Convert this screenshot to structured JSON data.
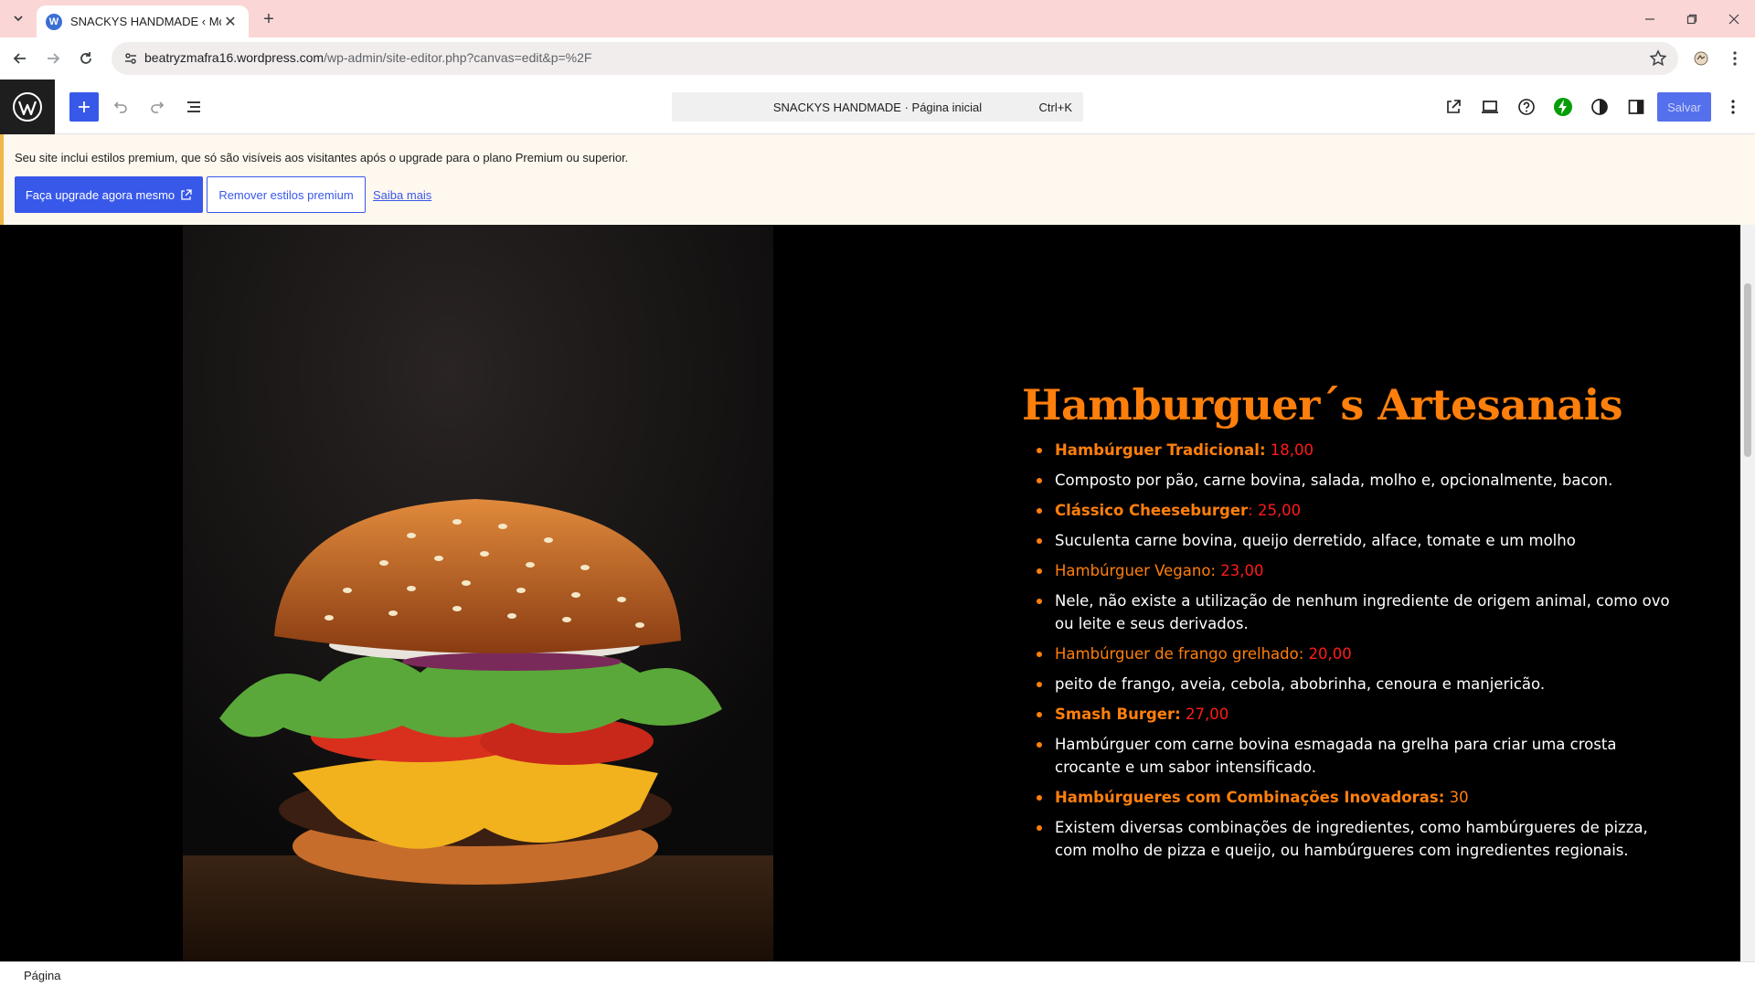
{
  "browser": {
    "tab_title": "SNACKYS HANDMADE ‹ Modelos",
    "url_host": "beatryzmafra16.wordpress.com",
    "url_path": "/wp-admin/site-editor.php?canvas=edit&p=%2F"
  },
  "editor": {
    "command_label": "SNACKYS HANDMADE · Página inicial",
    "command_shortcut": "Ctrl+K",
    "save_label": "Salvar"
  },
  "notice": {
    "message": "Seu site inclui estilos premium, que só são visíveis aos visitantes após o upgrade para o plano Premium ou superior.",
    "upgrade_label": "Faça upgrade agora mesmo",
    "remove_label": "Remover estilos premium",
    "learn_more_label": "Saiba mais"
  },
  "menu": {
    "heading": "Hamburguer´s Artesanais",
    "items": [
      {
        "name": "Hambúrguer Tradicional:",
        "price": " 18,00",
        "desc": "Composto por pão, carne bovina, salada, molho e, opcionalmente, bacon.",
        "bold": true
      },
      {
        "name": "Clássico Cheeseburger",
        "price": ": 25,00",
        "desc": "Suculenta carne bovina, queijo derretido, alface, tomate e um molho",
        "bold": true
      },
      {
        "name": "Hambúrguer Vegano:",
        "price": " 23,00",
        "desc": " Nele, não existe a utilização de nenhum ingrediente de origem animal, como ovo ou leite e seus derivados.",
        "bold": false
      },
      {
        "name": "Hambúrguer de frango grelhado:",
        "price": " 20,00",
        "desc": "peito de frango, aveia, cebola, abobrinha, cenoura e manjericão.",
        "bold": false
      },
      {
        "name": "Smash Burger:",
        "price": " 27,00",
        "desc": "Hambúrguer com carne bovina esmagada na grelha para criar uma crosta crocante e um sabor intensificado.",
        "bold": true
      },
      {
        "name": "Hambúrgueres com Combinações Inovadoras:",
        "price": " 30",
        "desc": " Existem diversas combinações de ingredientes, como hambúrgueres de pizza, com molho de pizza e queijo, ou hambúrgueres com ingredientes regionais.",
        "bold": true
      }
    ]
  },
  "footer": {
    "breadcrumb": "Página"
  },
  "colors": {
    "accent": "#3858e9",
    "menu_orange": "#ff7f0c",
    "price_red": "#ff1a1a"
  }
}
